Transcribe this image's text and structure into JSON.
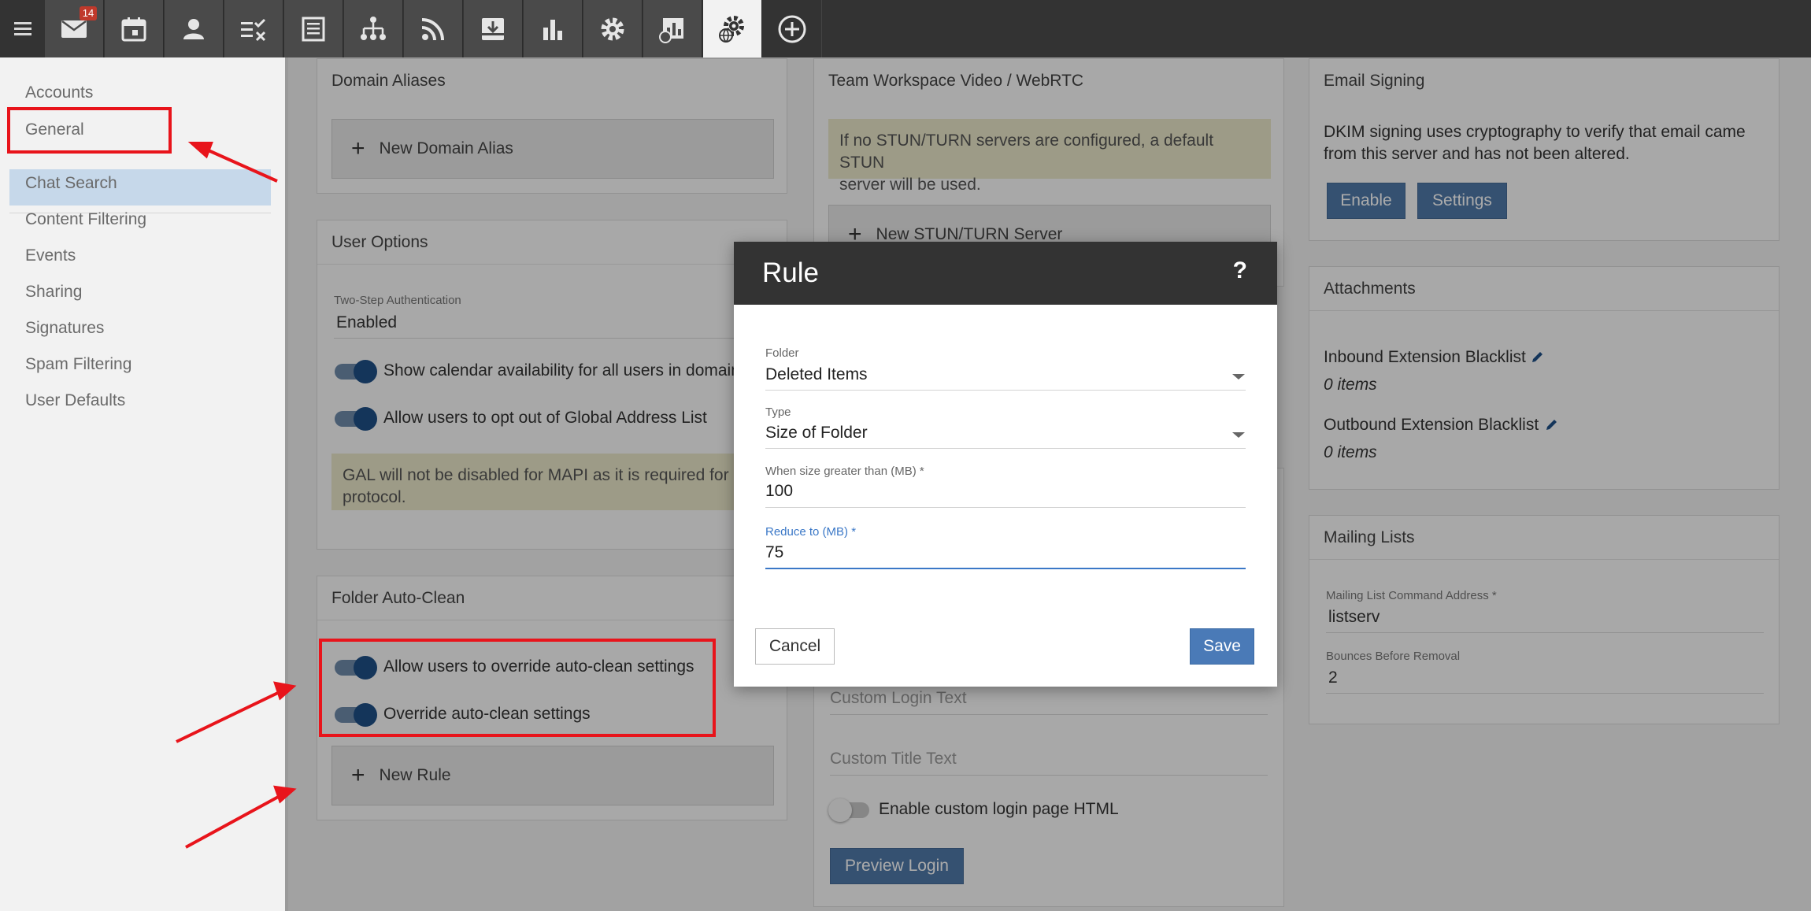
{
  "topbar": {
    "mail_badge": "14",
    "apps": [
      {
        "icon": "mail-icon"
      },
      {
        "icon": "calendar-icon"
      },
      {
        "icon": "contacts-icon"
      },
      {
        "icon": "tasks-icon"
      },
      {
        "icon": "notes-icon"
      },
      {
        "icon": "org-chart-icon"
      },
      {
        "icon": "rss-icon"
      },
      {
        "icon": "archive-icon"
      },
      {
        "icon": "reports-icon"
      },
      {
        "icon": "settings-icon"
      },
      {
        "icon": "domain-reports-icon"
      },
      {
        "icon": "domain-settings-icon",
        "active": true
      },
      {
        "icon": "add-icon"
      }
    ]
  },
  "sidebar": {
    "items": [
      {
        "label": "Accounts"
      },
      {
        "label": "General",
        "selected": true
      },
      {
        "label": "Chat Search"
      },
      {
        "label": "Content Filtering"
      },
      {
        "label": "Events"
      },
      {
        "label": "Sharing"
      },
      {
        "label": "Signatures"
      },
      {
        "label": "Spam Filtering"
      },
      {
        "label": "User Defaults"
      }
    ]
  },
  "domain_aliases": {
    "title": "Domain Aliases",
    "new_button": "New Domain Alias"
  },
  "user_options": {
    "title": "User Options",
    "two_step_label": "Two-Step Authentication",
    "two_step_value": "Enabled",
    "toggle_calendar": "Show calendar availability for all users in domain",
    "toggle_gal": "Allow users to opt out of Global Address List",
    "note_line1": "GAL will not be disabled for MAPI as it is required for",
    "note_line2": "protocol."
  },
  "folder_auto_clean": {
    "title": "Folder Auto-Clean",
    "toggle_allow_override": "Allow users to override auto-clean settings",
    "toggle_override": "Override auto-clean settings",
    "new_button": "New Rule"
  },
  "team_workspace": {
    "title": "Team Workspace Video / WebRTC",
    "note_line1": "If no STUN/TURN servers are configured, a default STUN",
    "note_line2": "server will be used.",
    "new_button": "New STUN/TURN Server"
  },
  "login_card": {
    "custom_login_text": "Custom Login Text",
    "custom_title_text": "Custom Title Text",
    "toggle_custom_html": "Enable custom login page HTML",
    "preview_button": "Preview Login"
  },
  "email_signing": {
    "title": "Email Signing",
    "text_line1": "DKIM signing uses cryptography to verify that email came",
    "text_line2": "from this server and has not been altered.",
    "enable_button": "Enable",
    "settings_button": "Settings"
  },
  "attachments": {
    "title": "Attachments",
    "inbound_label": "Inbound Extension Blacklist",
    "inbound_value": "0 items",
    "outbound_label": "Outbound Extension Blacklist",
    "outbound_value": "0 items"
  },
  "mailing_lists": {
    "title": "Mailing Lists",
    "command_label": "Mailing List Command Address *",
    "command_value": "listserv",
    "bounces_label": "Bounces Before Removal",
    "bounces_value": "2"
  },
  "modal": {
    "title": "Rule",
    "help": "?",
    "folder_label": "Folder",
    "folder_value": "Deleted Items",
    "type_label": "Type",
    "type_value": "Size of Folder",
    "size_label": "When size greater than (MB) *",
    "size_value": "100",
    "reduce_label": "Reduce to (MB) *",
    "reduce_value": "75",
    "cancel": "Cancel",
    "save": "Save"
  },
  "colors": {
    "topbar": "#333333",
    "primary_button": "#4a7ab7",
    "annotation_red": "#e8141b",
    "focus_blue": "#3b78c7"
  }
}
